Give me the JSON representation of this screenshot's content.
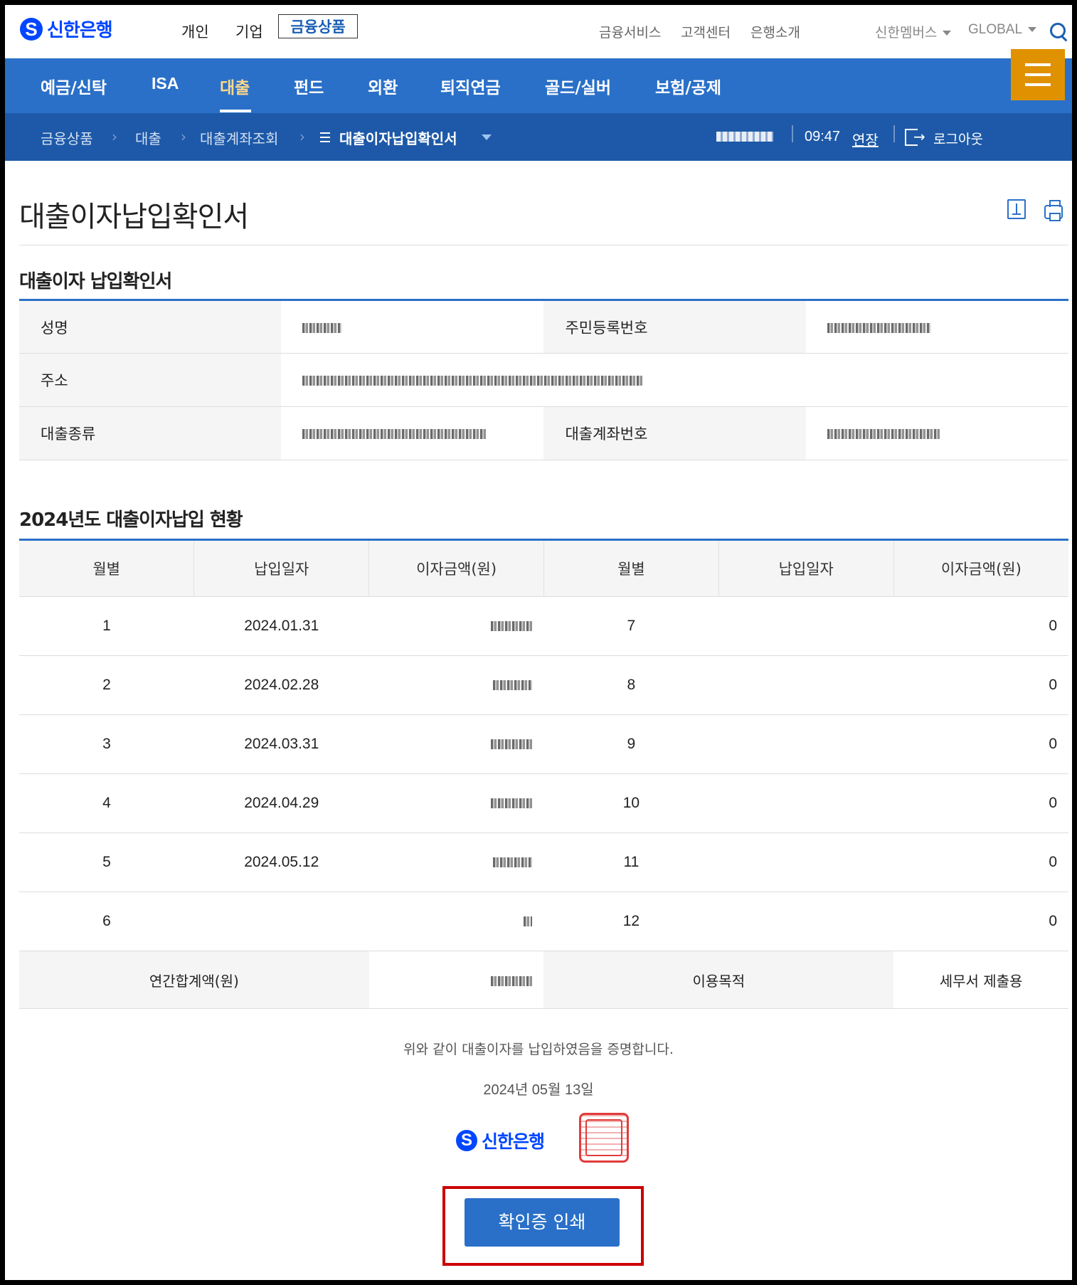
{
  "brand": {
    "name": "신한은행",
    "logo_mark": "S"
  },
  "top_tabs": [
    "개인",
    "기업",
    "금융상품"
  ],
  "top_links": [
    "금융서비스",
    "고객센터",
    "은행소개"
  ],
  "member_label": "신한멤버스",
  "global_label": "GLOBAL",
  "main_nav": [
    "예금/신탁",
    "ISA",
    "대출",
    "펀드",
    "외환",
    "퇴직연금",
    "골드/실버",
    "보험/공제"
  ],
  "breadcrumb": [
    "금융상품",
    "대출",
    "대출계좌조회",
    "대출이자납입확인서"
  ],
  "session": {
    "timer": "09:47",
    "extend_label": "연장",
    "logout_label": "로그아웃"
  },
  "page_title": "대출이자납입확인서",
  "info_section": {
    "title": "대출이자 납입확인서",
    "labels": {
      "name": "성명",
      "rrn": "주민등록번호",
      "address": "주소",
      "loan_type": "대출종류",
      "loan_account": "대출계좌번호"
    }
  },
  "detail_section": {
    "title": "2024년도 대출이자납입 현황",
    "headers": [
      "월별",
      "납입일자",
      "이자금액(원)",
      "월별",
      "납입일자",
      "이자금액(원)"
    ],
    "rows": [
      {
        "m1": "1",
        "d1": "2024.01.31",
        "m2": "7",
        "a2": "0"
      },
      {
        "m1": "2",
        "d1": "2024.02.28",
        "m2": "8",
        "a2": "0"
      },
      {
        "m1": "3",
        "d1": "2024.03.31",
        "m2": "9",
        "a2": "0"
      },
      {
        "m1": "4",
        "d1": "2024.04.29",
        "m2": "10",
        "a2": "0"
      },
      {
        "m1": "5",
        "d1": "2024.05.12",
        "m2": "11",
        "a2": "0"
      },
      {
        "m1": "6",
        "d1": "",
        "m2": "12",
        "a2": "0"
      }
    ],
    "summary": {
      "total_label": "연간합계액(원)",
      "purpose_label": "이용목적",
      "purpose_value": "세무서 제출용"
    }
  },
  "certification": {
    "statement": "위와 같이 대출이자를 납입하였음을 증명합니다.",
    "date": "2024년 05월 13일"
  },
  "print_button_label": "확인증 인쇄",
  "colors": {
    "nav_blue": "#2a70c8",
    "crumb_blue": "#1d59a8",
    "brand_blue": "#0046ff",
    "menu_orange": "#e09100",
    "highlight_red": "#cc0000"
  }
}
